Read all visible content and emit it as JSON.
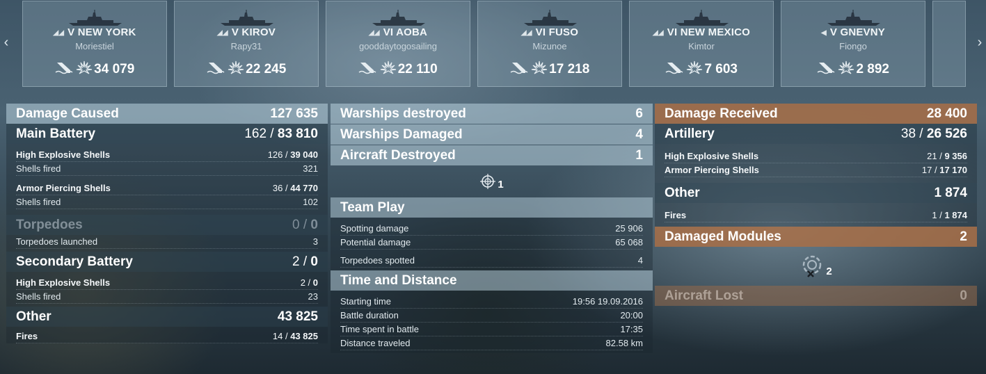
{
  "carousel": {
    "ships": [
      {
        "tier": "V",
        "name": "NEW YORK",
        "player": "Moriestiel",
        "damage": "34 079",
        "icon": "battleship-icon"
      },
      {
        "tier": "V",
        "name": "KIROV",
        "player": "Rapy31",
        "damage": "22 245",
        "icon": "cruiser-icon"
      },
      {
        "tier": "VI",
        "name": "AOBA",
        "player": "gooddaytogosailing",
        "damage": "22 110",
        "icon": "cruiser-icon"
      },
      {
        "tier": "VI",
        "name": "FUSO",
        "player": "Mizunoe",
        "damage": "17 218",
        "icon": "battleship-icon"
      },
      {
        "tier": "VI",
        "name": "NEW MEXICO",
        "player": "Kimtor",
        "damage": "7 603",
        "icon": "battleship-icon"
      },
      {
        "tier": "V",
        "name": "GNEVNY",
        "player": "Fiongo",
        "damage": "2 892",
        "icon": "destroyer-icon"
      }
    ]
  },
  "damage_caused": {
    "title": "Damage Caused",
    "value": "127 635",
    "main_battery": {
      "label": "Main Battery",
      "hits": "162",
      "damage": "83 810"
    },
    "he_shells": {
      "label": "High Explosive Shells",
      "hits": "126",
      "damage": "39 040",
      "fired_label": "Shells fired",
      "fired": "321"
    },
    "ap_shells": {
      "label": "Armor Piercing Shells",
      "hits": "36",
      "damage": "44 770",
      "fired_label": "Shells fired",
      "fired": "102"
    },
    "torpedoes": {
      "label": "Torpedoes",
      "hits": "0",
      "damage": "0",
      "launched_label": "Torpedoes launched",
      "launched": "3"
    },
    "secondary": {
      "label": "Secondary Battery",
      "hits": "2",
      "damage": "0",
      "he_label": "High Explosive Shells",
      "he_hits": "2",
      "he_damage": "0",
      "fired_label": "Shells fired",
      "fired": "23"
    },
    "other": {
      "label": "Other",
      "value": "43 825",
      "fires_label": "Fires",
      "fires_count": "14",
      "fires_damage": "43 825"
    }
  },
  "middle": {
    "warships_destroyed": {
      "label": "Warships destroyed",
      "value": "6"
    },
    "warships_damaged": {
      "label": "Warships Damaged",
      "value": "4"
    },
    "aircraft_destroyed": {
      "label": "Aircraft Destroyed",
      "value": "1"
    },
    "ribbon_count": "1",
    "team_play": {
      "title": "Team Play",
      "rows": [
        {
          "label": "Spotting damage",
          "value": "25 906"
        },
        {
          "label": "Potential damage",
          "value": "65 068"
        },
        {
          "label": "Torpedoes spotted",
          "value": "4"
        }
      ]
    },
    "time_distance": {
      "title": "Time and Distance",
      "rows": [
        {
          "label": "Starting time",
          "value": "19:56  19.09.2016"
        },
        {
          "label": "Battle duration",
          "value": "20:00"
        },
        {
          "label": "Time spent in battle",
          "value": "17:35"
        },
        {
          "label": "Distance traveled",
          "value": "82.58 km"
        }
      ]
    }
  },
  "damage_received": {
    "title": "Damage Received",
    "value": "28 400",
    "artillery": {
      "label": "Artillery",
      "hits": "38",
      "damage": "26 526"
    },
    "he_shells": {
      "label": "High Explosive Shells",
      "hits": "21",
      "damage": "9 356"
    },
    "ap_shells": {
      "label": "Armor Piercing Shells",
      "hits": "17",
      "damage": "17 170"
    },
    "other": {
      "label": "Other",
      "value": "1 874",
      "fires_label": "Fires",
      "fires_count": "1",
      "fires_damage": "1 874"
    },
    "damaged_modules": {
      "label": "Damaged Modules",
      "value": "2",
      "icon_count": "2"
    },
    "aircraft_lost": {
      "label": "Aircraft Lost",
      "value": "0"
    }
  },
  "colors": {
    "header_light": "#b4cad6",
    "header_orange": "#a86e46",
    "text": "#e8eef2"
  }
}
